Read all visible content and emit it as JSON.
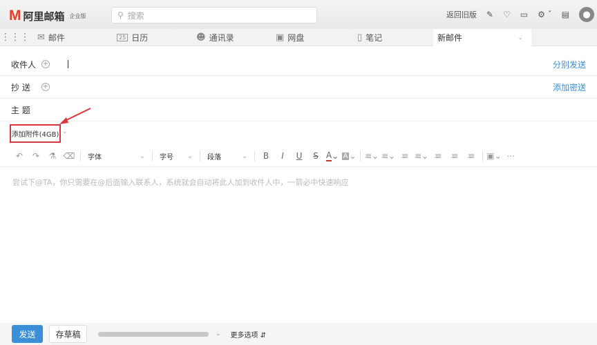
{
  "header": {
    "logo_text": "阿里邮箱",
    "edition": "企业版",
    "search_placeholder": "搜索",
    "old_version": "返回旧版",
    "icons": [
      "wrench-icon",
      "bell-icon",
      "devices-icon",
      "gear-icon",
      "feedback-icon",
      "avatar-icon"
    ]
  },
  "nav": {
    "items": [
      {
        "label": "邮件",
        "icon": "mail-icon"
      },
      {
        "label": "日历",
        "icon": "calendar-icon",
        "icon_text": "25"
      },
      {
        "label": "通讯录",
        "icon": "contacts-icon"
      },
      {
        "label": "网盘",
        "icon": "drive-icon"
      },
      {
        "label": "笔记",
        "icon": "note-icon"
      }
    ],
    "active_tab": "新邮件"
  },
  "compose": {
    "to_label": "收件人",
    "cc_label": "抄 送",
    "subject_label": "主 题",
    "send_separately": "分别发送",
    "add_bcc": "添加密送",
    "attach_label": "添加附件(4GB)"
  },
  "toolbar": {
    "font": "字体",
    "size": "字号",
    "paragraph": "段落"
  },
  "body_placeholder": "尝试下@TA，你只需要在@后面输入联系人，系统就会自动将此人加到收件人中，一箭必中快速响应",
  "footer": {
    "send": "发送",
    "draft": "存草稿",
    "more_options": "更多选项"
  },
  "colors": {
    "accent": "#3b8ed8",
    "brand": "#e0432b",
    "highlight": "#d9363e"
  }
}
